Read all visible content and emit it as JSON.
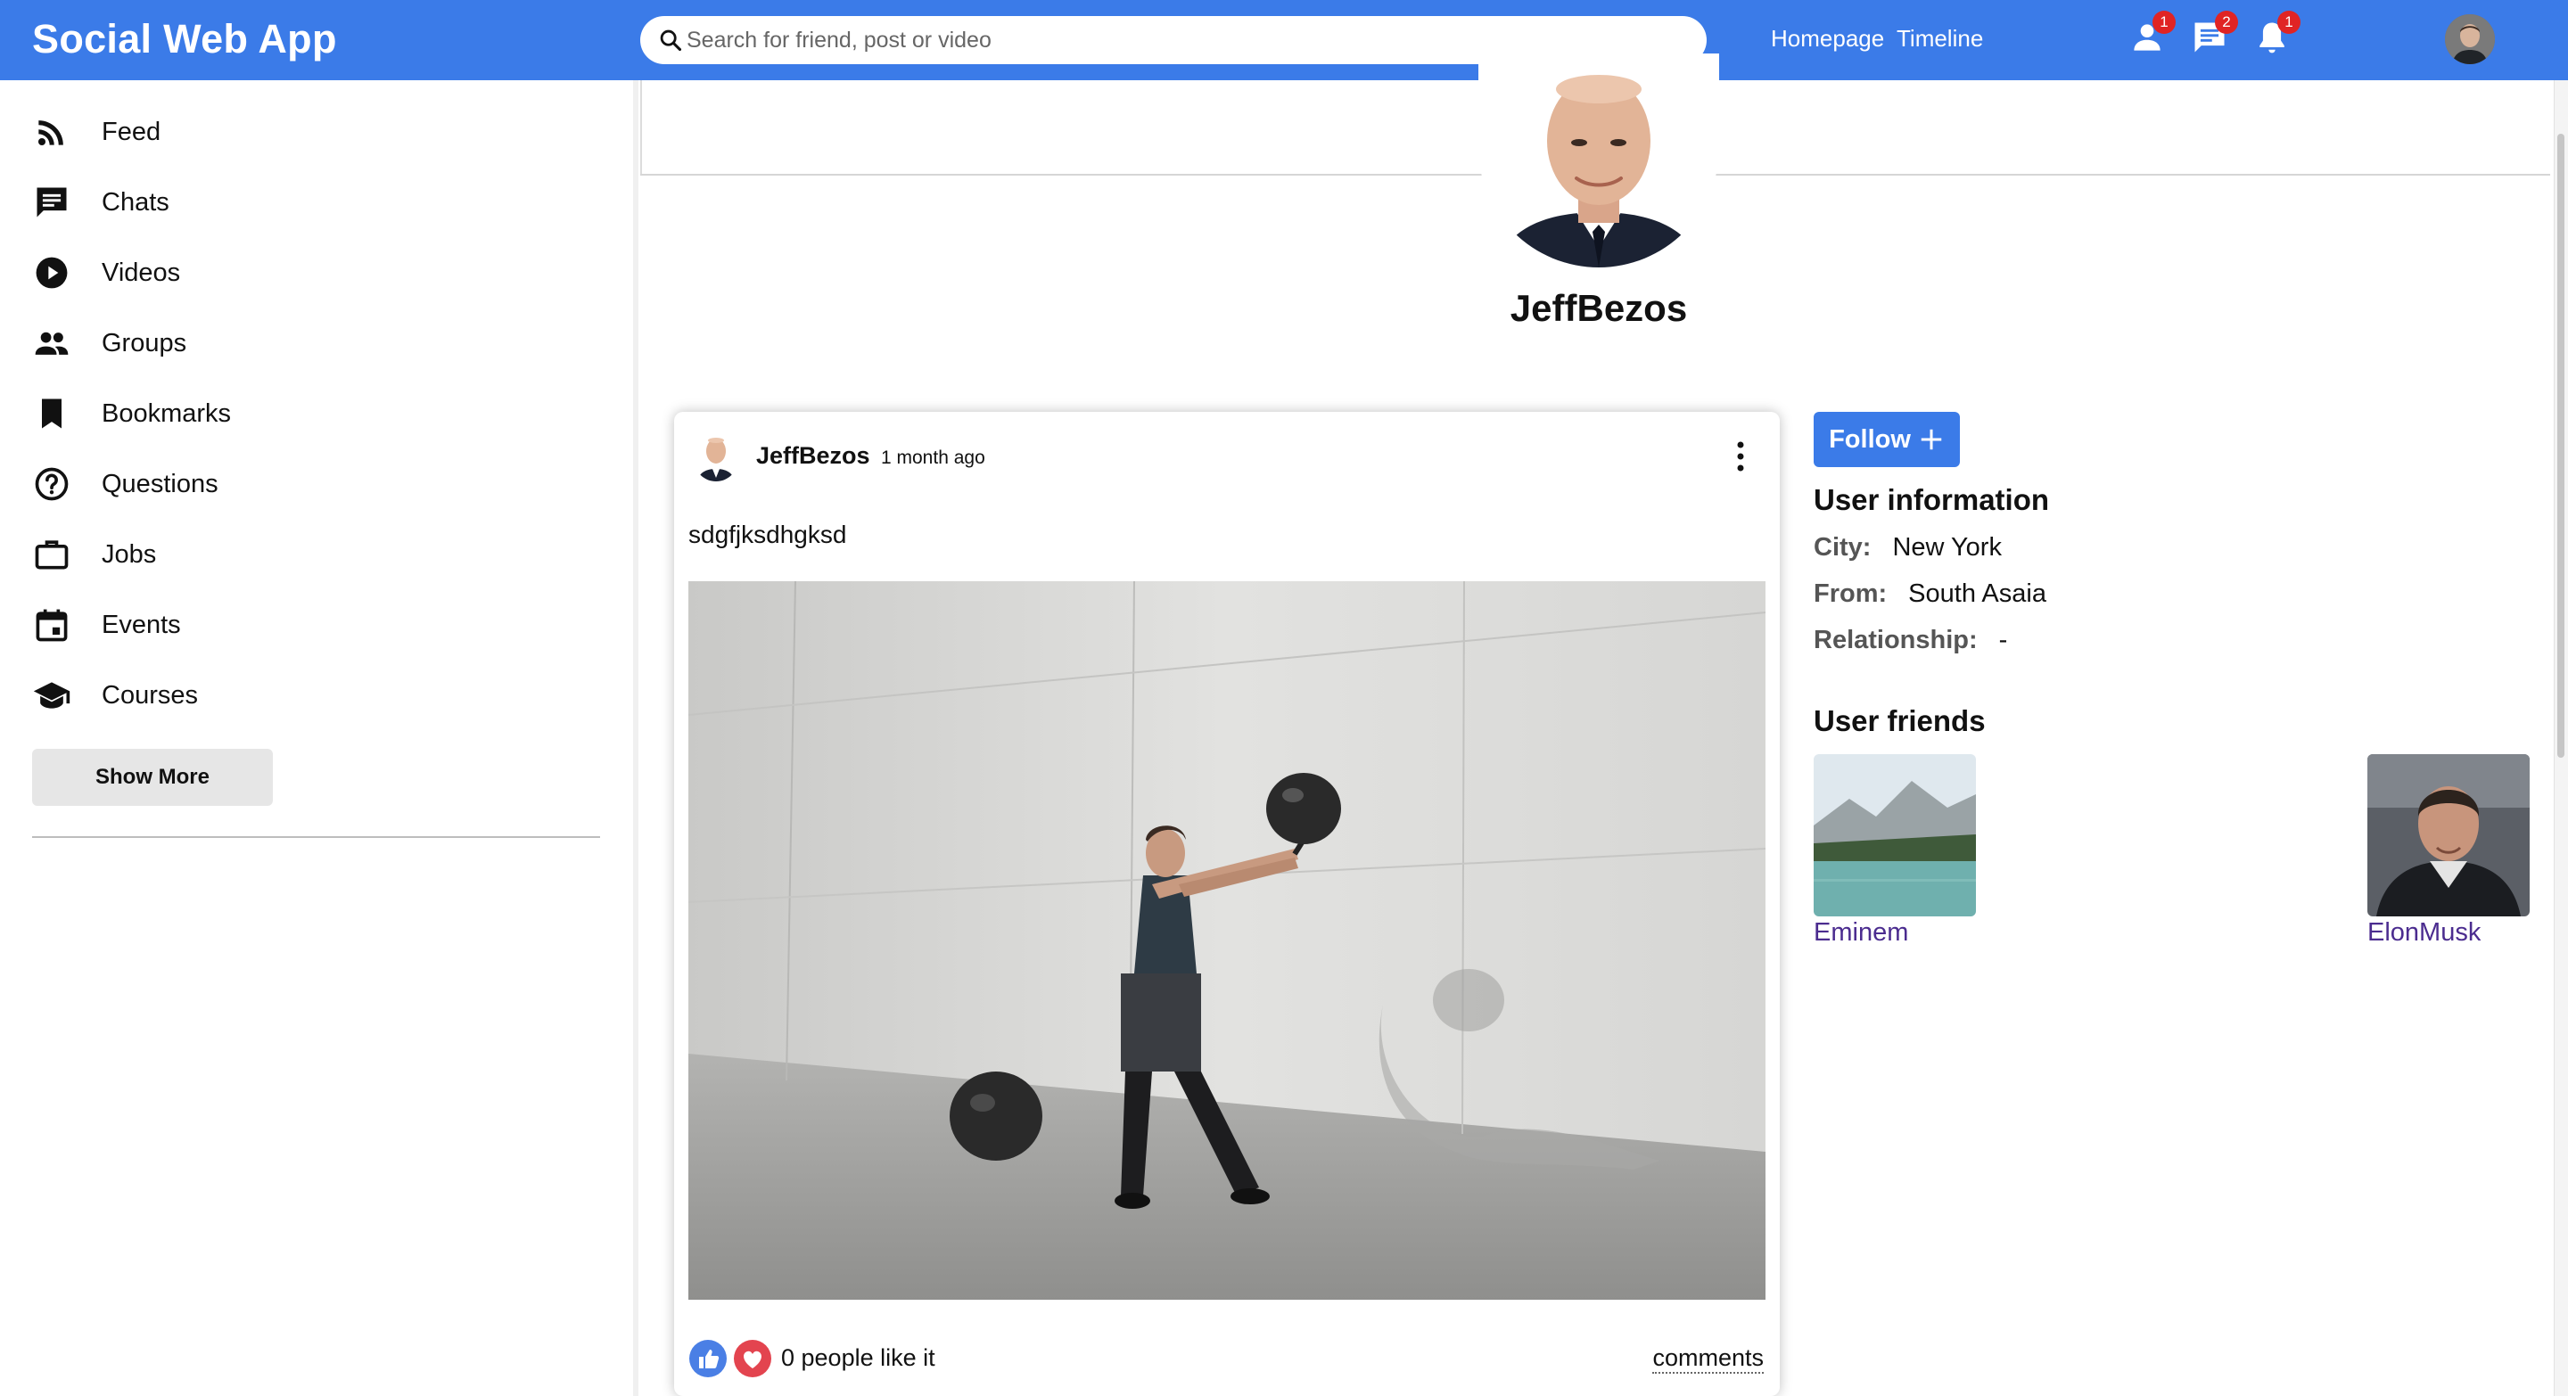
{
  "app": {
    "title": "Social Web App"
  },
  "search": {
    "placeholder": "Search for friend, post or video"
  },
  "topbar": {
    "links": [
      "Homepage",
      "Timeline"
    ],
    "badges": {
      "friend_requests": "1",
      "messages": "2",
      "notifications": "1"
    },
    "icons": [
      "person-icon",
      "chat-icon",
      "bell-icon"
    ]
  },
  "sidebar": {
    "items": [
      {
        "label": "Feed",
        "icon": "rss-feed-icon"
      },
      {
        "label": "Chats",
        "icon": "chat-icon"
      },
      {
        "label": "Videos",
        "icon": "play-circle-icon"
      },
      {
        "label": "Groups",
        "icon": "group-icon"
      },
      {
        "label": "Bookmarks",
        "icon": "bookmark-icon"
      },
      {
        "label": "Questions",
        "icon": "help-circle-icon"
      },
      {
        "label": "Jobs",
        "icon": "briefcase-icon"
      },
      {
        "label": "Events",
        "icon": "calendar-icon"
      },
      {
        "label": "Courses",
        "icon": "school-icon"
      }
    ],
    "show_more": "Show More"
  },
  "profile": {
    "username": "JeffBezos"
  },
  "post": {
    "author": "JeffBezos",
    "time": "1 month ago",
    "text": "sdgfjksdhgksd",
    "likes": "0 people like it",
    "comments": "comments"
  },
  "user_info": {
    "follow_label": "Follow",
    "title": "User information",
    "city_label": "City:",
    "city": "New York",
    "from_label": "From:",
    "from": "South Asaia",
    "relationship_label": "Relationship:",
    "relationship": "-"
  },
  "friends": {
    "title": "User friends",
    "list": [
      {
        "name": "Eminem"
      },
      {
        "name": "ElonMusk"
      }
    ]
  },
  "colors": {
    "accent": "#3b7be8",
    "badge": "#e02424",
    "friend_link": "#4b2c8f"
  }
}
